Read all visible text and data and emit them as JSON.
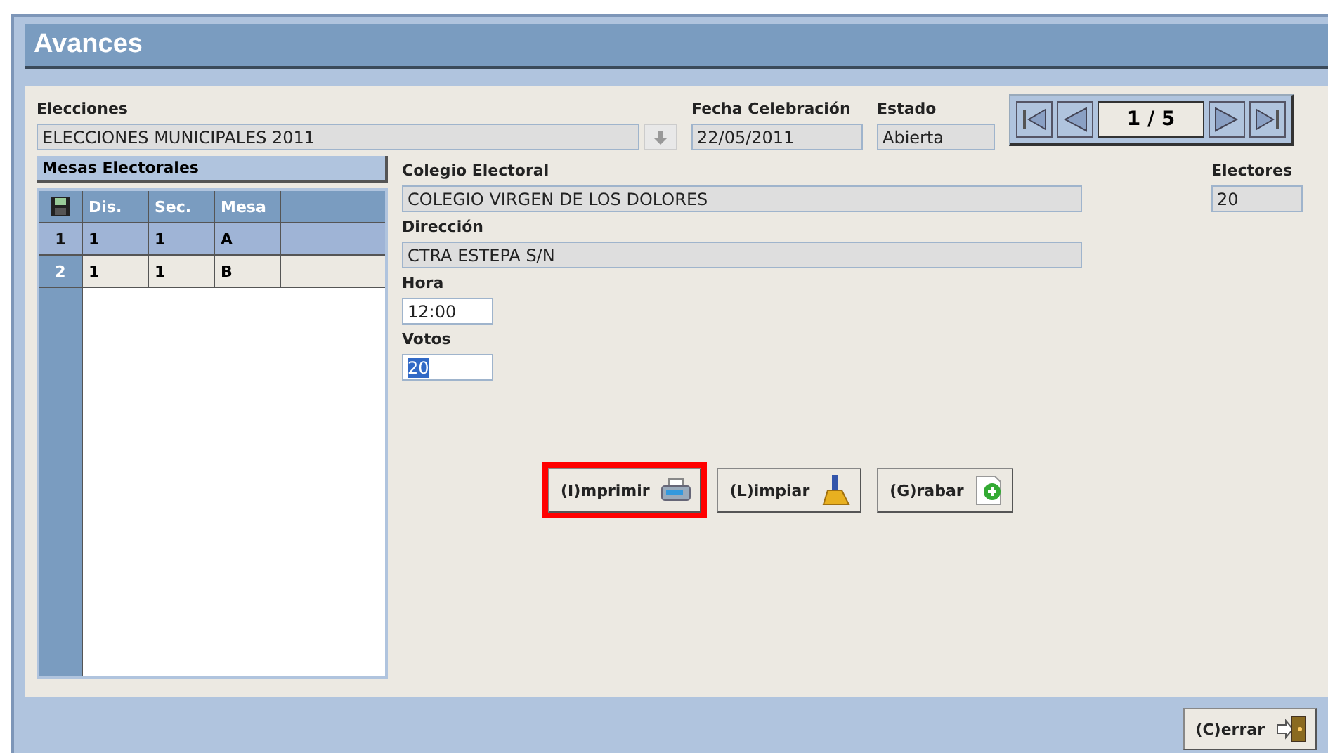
{
  "window": {
    "title": "Avances"
  },
  "elecciones": {
    "label": "Elecciones",
    "value": "ELECCIONES MUNICIPALES 2011"
  },
  "fecha": {
    "label": "Fecha Celebración",
    "value": "22/05/2011"
  },
  "estado": {
    "label": "Estado",
    "value": "Abierta"
  },
  "navigator": {
    "position": "1 / 5"
  },
  "mesas": {
    "title": "Mesas Electorales",
    "columns": [
      "Dis.",
      "Sec.",
      "Mesa"
    ],
    "rows": [
      {
        "number": "1",
        "cells": [
          "1",
          "1",
          "A"
        ],
        "selected": true
      },
      {
        "number": "2",
        "cells": [
          "1",
          "1",
          "B"
        ],
        "selected": false
      }
    ]
  },
  "fields": [
    {
      "label": "Colegio Electoral",
      "value": "COLEGIO VIRGEN DE LOS DOLORES",
      "kind": "wide",
      "editable": false
    },
    {
      "label": "Dirección",
      "value": "CTRA ESTEPA S/N",
      "kind": "wide",
      "editable": false
    },
    {
      "label": "Hora",
      "value": "12:00",
      "kind": "short",
      "editable": true
    },
    {
      "label": "Votos",
      "value": "20",
      "kind": "short",
      "editable": true,
      "text_selected": true
    }
  ],
  "electores": {
    "label": "Electores",
    "value": "20"
  },
  "buttons": [
    {
      "label": "(I)mprimir",
      "kind": "printer",
      "highlighted": true
    },
    {
      "label": "(L)impiar",
      "kind": "brush",
      "highlighted": false
    },
    {
      "label": "(G)rabar",
      "kind": "add",
      "highlighted": false
    }
  ],
  "close_button": {
    "label": "(C)errar"
  }
}
